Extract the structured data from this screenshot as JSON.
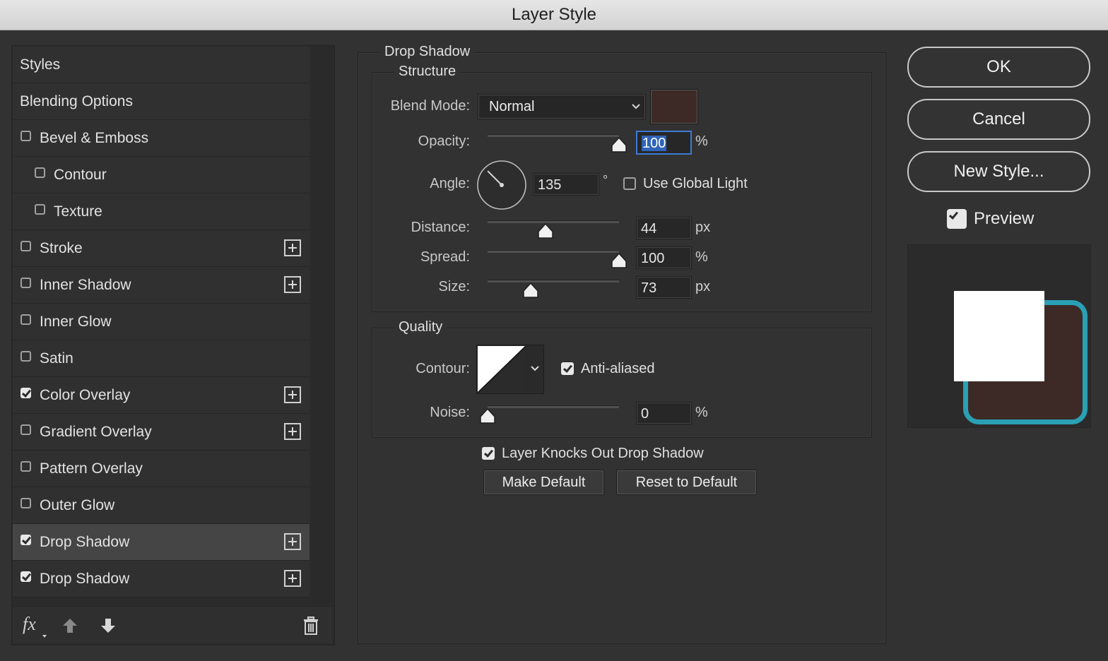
{
  "window": {
    "title": "Layer Style"
  },
  "styles_list": {
    "rows": [
      {
        "label": "Styles",
        "has_checkbox": false,
        "checked": false,
        "indent": false,
        "has_plus": false,
        "selected": false
      },
      {
        "label": "Blending Options",
        "has_checkbox": false,
        "checked": false,
        "indent": false,
        "has_plus": false,
        "selected": false
      },
      {
        "label": "Bevel & Emboss",
        "has_checkbox": true,
        "checked": false,
        "indent": false,
        "has_plus": false,
        "selected": false
      },
      {
        "label": "Contour",
        "has_checkbox": true,
        "checked": false,
        "indent": true,
        "has_plus": false,
        "selected": false
      },
      {
        "label": "Texture",
        "has_checkbox": true,
        "checked": false,
        "indent": true,
        "has_plus": false,
        "selected": false
      },
      {
        "label": "Stroke",
        "has_checkbox": true,
        "checked": false,
        "indent": false,
        "has_plus": true,
        "selected": false
      },
      {
        "label": "Inner Shadow",
        "has_checkbox": true,
        "checked": false,
        "indent": false,
        "has_plus": true,
        "selected": false
      },
      {
        "label": "Inner Glow",
        "has_checkbox": true,
        "checked": false,
        "indent": false,
        "has_plus": false,
        "selected": false
      },
      {
        "label": "Satin",
        "has_checkbox": true,
        "checked": false,
        "indent": false,
        "has_plus": false,
        "selected": false
      },
      {
        "label": "Color Overlay",
        "has_checkbox": true,
        "checked": true,
        "indent": false,
        "has_plus": true,
        "selected": false
      },
      {
        "label": "Gradient Overlay",
        "has_checkbox": true,
        "checked": false,
        "indent": false,
        "has_plus": true,
        "selected": false
      },
      {
        "label": "Pattern Overlay",
        "has_checkbox": true,
        "checked": false,
        "indent": false,
        "has_plus": false,
        "selected": false
      },
      {
        "label": "Outer Glow",
        "has_checkbox": true,
        "checked": false,
        "indent": false,
        "has_plus": false,
        "selected": false
      },
      {
        "label": "Drop Shadow",
        "has_checkbox": true,
        "checked": true,
        "indent": false,
        "has_plus": true,
        "selected": true
      },
      {
        "label": "Drop Shadow",
        "has_checkbox": true,
        "checked": true,
        "indent": false,
        "has_plus": true,
        "selected": false
      }
    ],
    "bottom_icons": [
      "fx-icon",
      "move-up-icon",
      "move-down-icon",
      "trash-icon"
    ],
    "fx_label": "fx"
  },
  "drop_shadow": {
    "section_title": "Drop Shadow",
    "structure": {
      "title": "Structure",
      "blend_mode_label": "Blend Mode:",
      "blend_mode_value": "Normal",
      "shadow_color": "#3d2a26",
      "opacity_label": "Opacity:",
      "opacity_value": "100",
      "opacity_unit": "%",
      "opacity_fraction": 1.0,
      "angle_label": "Angle:",
      "angle_value": "135",
      "angle_unit": "°",
      "angle_degrees": 135,
      "use_global_light_label": "Use Global Light",
      "use_global_light": false,
      "distance_label": "Distance:",
      "distance_value": "44",
      "distance_unit": "px",
      "distance_fraction": 0.44,
      "spread_label": "Spread:",
      "spread_value": "100",
      "spread_unit": "%",
      "spread_fraction": 1.0,
      "size_label": "Size:",
      "size_value": "73",
      "size_unit": "px",
      "size_fraction": 0.33
    },
    "quality": {
      "title": "Quality",
      "contour_label": "Contour:",
      "anti_aliased_label": "Anti-aliased",
      "anti_aliased": true,
      "noise_label": "Noise:",
      "noise_value": "0",
      "noise_unit": "%",
      "noise_fraction": 0.0
    },
    "layer_knocks_out_label": "Layer Knocks Out Drop Shadow",
    "layer_knocks_out": true,
    "make_default_label": "Make Default",
    "reset_default_label": "Reset to Default"
  },
  "actions": {
    "ok_label": "OK",
    "cancel_label": "Cancel",
    "new_style_label": "New Style...",
    "preview_label": "Preview",
    "preview_checked": true
  },
  "preview": {
    "fill_color": "#ffffff",
    "shadow_color": "#3d2a26",
    "stroke_color": "#2aa0b4"
  }
}
